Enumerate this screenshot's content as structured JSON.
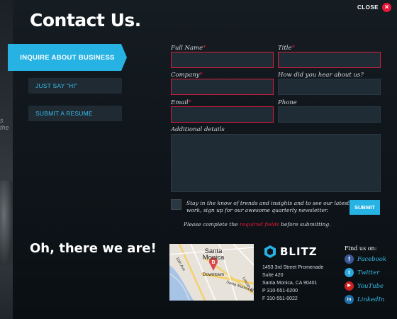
{
  "page": {
    "title": "Contact Us.",
    "close_label": "CLOSE"
  },
  "background": {
    "snippet": "s the"
  },
  "tabs": [
    {
      "label": "INQUIRE ABOUT BUSINESS",
      "active": true
    },
    {
      "label": "JUST SAY \"HI\"",
      "active": false
    },
    {
      "label": "SUBMIT A RESUME",
      "active": false
    }
  ],
  "form": {
    "full_name": {
      "label": "Full Name",
      "required_mark": "*",
      "value": ""
    },
    "title": {
      "label": "Title",
      "required_mark": "*",
      "value": ""
    },
    "company": {
      "label": "Company",
      "required_mark": "*",
      "value": ""
    },
    "heard": {
      "label": "How did you hear about us?",
      "value": ""
    },
    "email": {
      "label": "Email",
      "required_mark": "*",
      "value": ""
    },
    "phone": {
      "label": "Phone",
      "value": ""
    },
    "details": {
      "label": "Additional details",
      "value": ""
    },
    "newsletter_text": "Stay in the know of trends and insights and to see our latest work, sign up for our awesome quarterly newsletter.",
    "submit_label": "SUBMIT",
    "notice_before": "Please complete the ",
    "notice_link": "required fields",
    "notice_after": " before submitting."
  },
  "location": {
    "heading": "Oh, there we are!",
    "map": {
      "city": "Santa",
      "city2": "Monica",
      "marker": "B",
      "area": "Downtown",
      "road1": "10th Ave",
      "road2": "Santa Monica Bl",
      "road3": "Lincoln Bl"
    }
  },
  "company": {
    "logo_text": "BLITZ",
    "address": [
      "1453 3rd Street Promenade",
      "Suite 420",
      "Santa Monica, CA 90401",
      "P 310-551-0200",
      "F 310-551-0022"
    ]
  },
  "social": {
    "heading": "Find us on:",
    "items": [
      {
        "name": "Facebook",
        "glyph": "f",
        "color": "#3b5998"
      },
      {
        "name": "Twitter",
        "glyph": "t",
        "color": "#2aa9e0"
      },
      {
        "name": "YouTube",
        "glyph": "▶",
        "color": "#cc2222"
      },
      {
        "name": "LinkedIn",
        "glyph": "in",
        "color": "#1f6ea8"
      }
    ]
  },
  "colors": {
    "accent": "#27b2e4",
    "error": "#d81b3d",
    "close": "#e8183a"
  }
}
